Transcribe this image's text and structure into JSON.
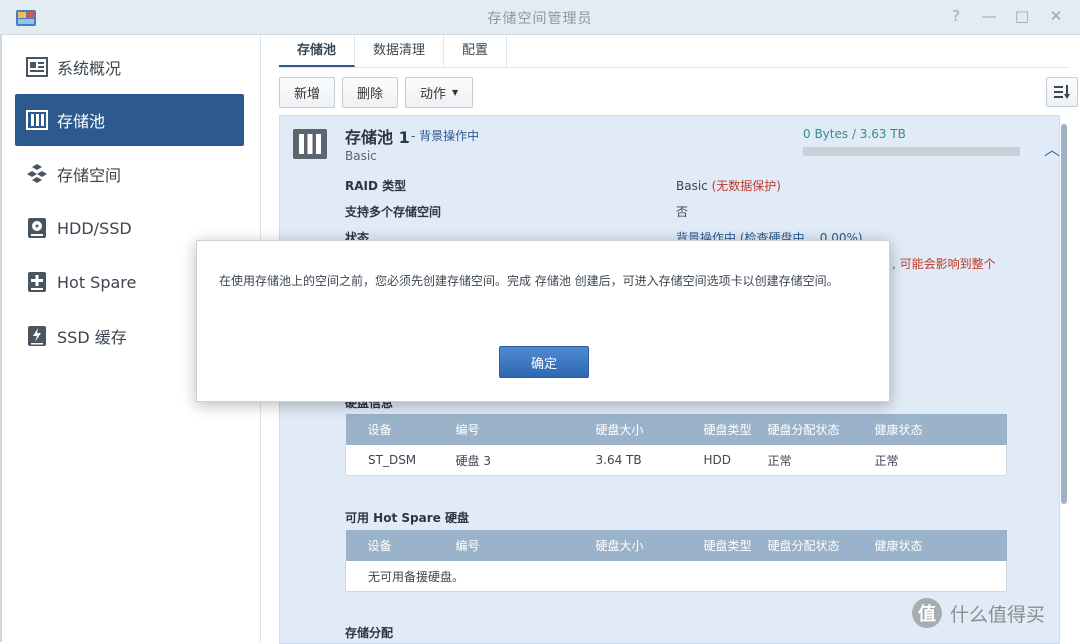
{
  "window": {
    "title": "存储空间管理员",
    "controls": [
      "?",
      "—",
      "□",
      "✕"
    ]
  },
  "sidebar": {
    "items": [
      {
        "label": "系统概况",
        "icon": "overview-icon"
      },
      {
        "label": "存储池",
        "icon": "storage-pool-icon",
        "active": true
      },
      {
        "label": "存储空间",
        "icon": "volume-icon"
      },
      {
        "label": "HDD/SSD",
        "icon": "hdd-icon"
      },
      {
        "label": "Hot Spare",
        "icon": "hot-spare-icon"
      },
      {
        "label": "SSD 缓存",
        "icon": "ssd-cache-icon"
      }
    ]
  },
  "tabs": [
    "存储池",
    "数据清理",
    "配置"
  ],
  "toolbar": {
    "create": "新增",
    "delete": "删除",
    "action": "动作"
  },
  "pool": {
    "title": "存储池 1",
    "status": "- 背景操作中",
    "type": "Basic",
    "usage_text": "0 Bytes / 3.63 TB",
    "usage_fraction": 0.0,
    "props": [
      {
        "label": "RAID 类型",
        "value": "Basic",
        "warn": "(无数据保护)"
      },
      {
        "label": "支持多个存储空间",
        "value": "否"
      },
      {
        "label": "状态",
        "value": "背景操作中 (检查硬盘中... 0.00%)"
      }
    ],
    "side_warning": ", 可能会影响到整个",
    "disk_info": {
      "title": "硬盘信息",
      "columns": [
        "设备",
        "编号",
        "硬盘大小",
        "硬盘类型",
        "硬盘分配状态",
        "健康状态"
      ],
      "rows": [
        [
          "ST_DSM",
          "硬盘 3",
          "3.64 TB",
          "HDD",
          "正常",
          "正常"
        ]
      ]
    },
    "hot_spare": {
      "title": "可用 Hot Spare 硬盘",
      "columns": [
        "设备",
        "编号",
        "硬盘大小",
        "硬盘类型",
        "硬盘分配状态",
        "健康状态"
      ],
      "empty": "无可用备援硬盘。"
    },
    "allocation_title": "存储分配"
  },
  "dialog": {
    "message": "在使用存储池上的空间之前，您必须先创建存储空间。完成 存储池 创建后，可进入存储空间选项卡以创建存储空间。",
    "ok": "确定"
  },
  "watermark": {
    "badge": "值",
    "text": "什么值得买"
  }
}
